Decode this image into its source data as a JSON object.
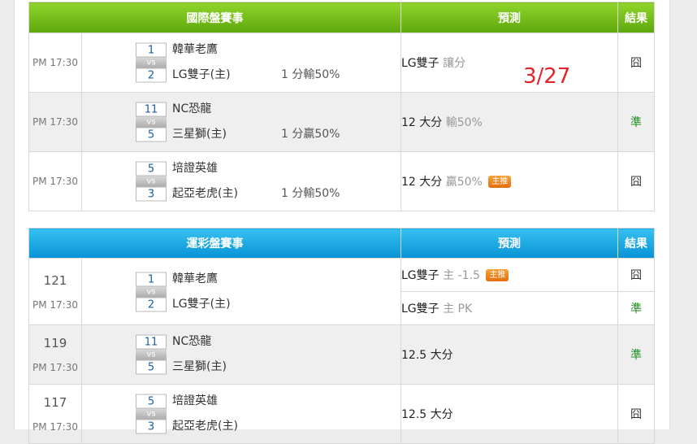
{
  "intl": {
    "header": {
      "col_match": "國際盤賽事",
      "col_pred": "預測",
      "col_result": "結果"
    },
    "note": "3/27",
    "rows": [
      {
        "time": "PM 17:30",
        "s1": "1",
        "vs": "vs",
        "s2": "2",
        "t1": "韓華老鷹",
        "t2": "LG雙子(主)",
        "res": "1 分輸50%",
        "pred": "LG雙子",
        "pred_extra": "讓分",
        "result": "囧"
      },
      {
        "time": "PM 17:30",
        "s1": "11",
        "vs": "vs",
        "s2": "5",
        "t1": "NC恐龍",
        "t2": "三星獅(主)",
        "res": "1 分贏50%",
        "pred": "12 大分",
        "pred_extra": "輸50%",
        "result": "準"
      },
      {
        "time": "PM 17:30",
        "s1": "5",
        "vs": "vs",
        "s2": "3",
        "t1": "培證英雄",
        "t2": "起亞老虎(主)",
        "res": "1 分輸50%",
        "pred": "12 大分",
        "pred_extra": "贏50%",
        "badge": "主推",
        "result": "囧"
      }
    ]
  },
  "lottery": {
    "header": {
      "col_match": "運彩盤賽事",
      "col_pred": "預測",
      "col_result": "結果"
    },
    "rows": [
      {
        "num": "121",
        "time": "PM 17:30",
        "s1": "1",
        "vs": "vs",
        "s2": "2",
        "t1": "韓華老鷹",
        "t2": "LG雙子(主)",
        "pred_a": "LG雙子",
        "pred_a_extra": "主 -1.5",
        "badge": "主推",
        "result_a": "囧",
        "pred_b": "LG雙子",
        "pred_b_extra": "主 PK",
        "result_b": "準"
      },
      {
        "num": "119",
        "time": "PM 17:30",
        "s1": "11",
        "vs": "vs",
        "s2": "5",
        "t1": "NC恐龍",
        "t2": "三星獅(主)",
        "pred": "12.5 大分",
        "result": "準"
      },
      {
        "num": "117",
        "time": "PM 17:30",
        "s1": "5",
        "vs": "vs",
        "s2": "3",
        "t1": "培證英雄",
        "t2": "起亞老虎(主)",
        "pred": "12.5 大分",
        "result": "囧"
      }
    ]
  }
}
